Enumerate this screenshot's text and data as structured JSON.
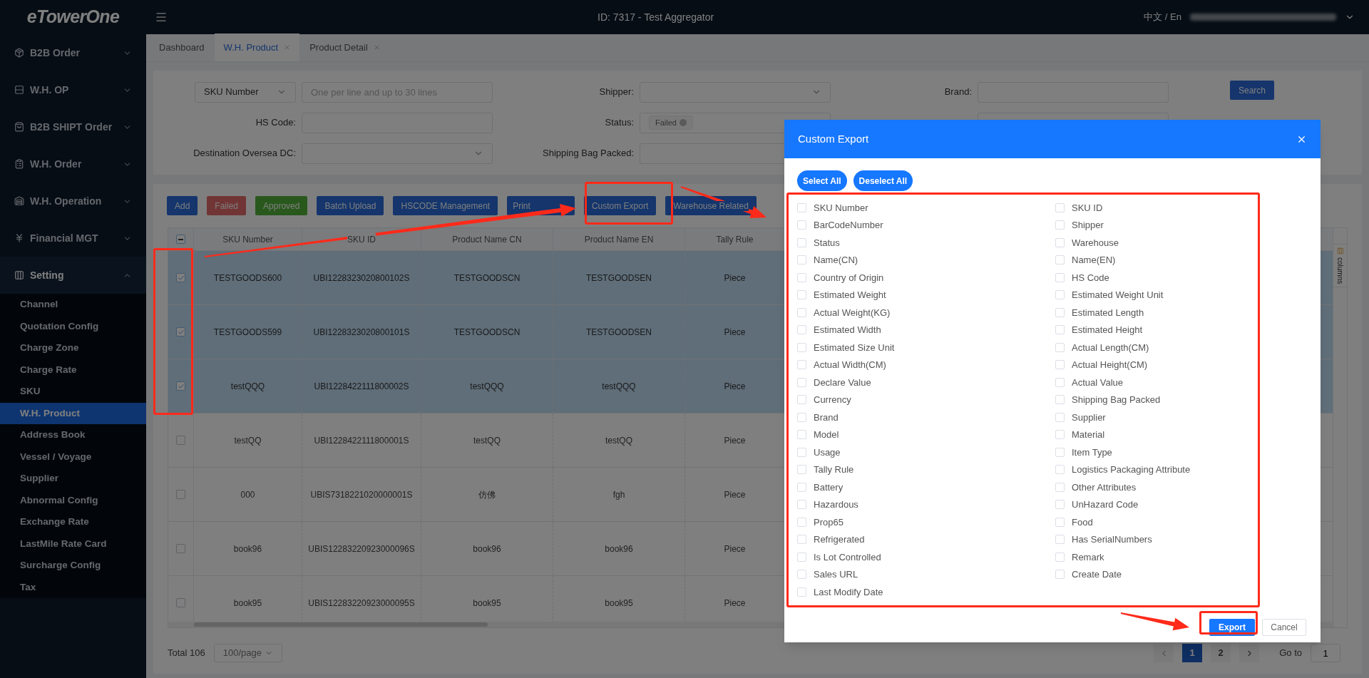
{
  "brand": "eTowerOne",
  "header": {
    "title": "ID: 7317 - Test Aggregator",
    "language": "中文 / En"
  },
  "sidebar": {
    "groups": [
      {
        "label": "B2B Order",
        "expanded": false
      },
      {
        "label": "W.H. OP",
        "expanded": false
      },
      {
        "label": "B2B SHIPT Order",
        "expanded": false
      },
      {
        "label": "W.H. Order",
        "expanded": false
      },
      {
        "label": "W.H. Operation",
        "expanded": false
      },
      {
        "label": "Financial MGT",
        "expanded": false
      },
      {
        "label": "Setting",
        "expanded": true,
        "children": [
          {
            "label": "Channel",
            "selected": false
          },
          {
            "label": "Quotation Config",
            "selected": false
          },
          {
            "label": "Charge Zone",
            "selected": false
          },
          {
            "label": "Charge Rate",
            "selected": false
          },
          {
            "label": "SKU",
            "selected": false
          },
          {
            "label": "W.H. Product",
            "selected": true
          },
          {
            "label": "Address Book",
            "selected": false
          },
          {
            "label": "Vessel / Voyage",
            "selected": false
          },
          {
            "label": "Supplier",
            "selected": false
          },
          {
            "label": "Abnormal Config",
            "selected": false
          },
          {
            "label": "Exchange Rate",
            "selected": false
          },
          {
            "label": "LastMile Rate Card",
            "selected": false
          },
          {
            "label": "Surcharge Config",
            "selected": false
          },
          {
            "label": "Tax",
            "selected": false
          }
        ]
      }
    ]
  },
  "tabs": [
    {
      "label": "Dashboard",
      "selected": false,
      "closable": false
    },
    {
      "label": "W.H. Product",
      "selected": true,
      "closable": true
    },
    {
      "label": "Product Detail",
      "selected": false,
      "closable": true
    }
  ],
  "filters": {
    "rows": [
      [
        {
          "kind": "select-input",
          "value": "SKU Number",
          "placeholder": "One per line and up to 30 lines"
        },
        {
          "kind": "select",
          "label": "Shipper:"
        },
        {
          "kind": "input",
          "label": "Brand:"
        }
      ],
      [
        {
          "kind": "input",
          "label": "HS Code:"
        },
        {
          "kind": "tags",
          "label": "Status:",
          "tags": [
            "Failed"
          ]
        },
        {
          "kind": "input"
        }
      ],
      [
        {
          "kind": "select",
          "label": "Destination Oversea DC:"
        },
        {
          "kind": "input",
          "label": "Shipping Bag Packed:"
        }
      ]
    ],
    "search": "Search"
  },
  "toolbar": [
    {
      "label": "Add",
      "kind": "primary"
    },
    {
      "label": "Failed",
      "kind": "danger"
    },
    {
      "label": "Approved",
      "kind": "success"
    },
    {
      "label": "Batch Upload",
      "kind": "primary"
    },
    {
      "label": "HSCODE Management",
      "kind": "primary"
    },
    {
      "label": "Print",
      "kind": "primary"
    },
    {
      "label": "Custom Export",
      "kind": "primary"
    },
    {
      "label": "Warehouse Related",
      "kind": "primary"
    }
  ],
  "table": {
    "header_checkbox": {
      "indeterminate": true
    },
    "columns": [
      "SKU Number",
      "SKU ID",
      "Product Name CN",
      "Product Name EN",
      "Tally Rule"
    ],
    "rows": [
      {
        "selected": true,
        "cells": [
          "TESTGOODS600",
          "UBI1228323020800102S",
          "TESTGOODSCN",
          "TESTGOODSEN",
          "Piece"
        ]
      },
      {
        "selected": true,
        "cells": [
          "TESTGOODS599",
          "UBI1228323020800101S",
          "TESTGOODSCN",
          "TESTGOODSEN",
          "Piece"
        ]
      },
      {
        "selected": true,
        "cells": [
          "testQQQ",
          "UBI1228422111800002S",
          "testQQQ",
          "testQQQ",
          "Piece"
        ]
      },
      {
        "selected": false,
        "cells": [
          "testQQ",
          "UBI1228422111800001S",
          "testQQ",
          "testQQ",
          "Piece"
        ]
      },
      {
        "selected": false,
        "cells": [
          "000",
          "UBIS7318221020000001S",
          "仿佛",
          "fgh",
          "Piece"
        ]
      },
      {
        "selected": false,
        "cells": [
          "book96",
          "UBIS12283220923000096S",
          "book96",
          "book96",
          "Piece"
        ]
      },
      {
        "selected": false,
        "cells": [
          "book95",
          "UBIS12283220923000095S",
          "book95",
          "book95",
          "Piece"
        ]
      }
    ],
    "columns_tab": "columns"
  },
  "pagination": {
    "total": "Total 106",
    "page_size": "100/page",
    "pages": [
      {
        "label": "1",
        "selected": true
      },
      {
        "label": "2",
        "selected": false
      }
    ],
    "goto": "Go to",
    "goto_value": "1"
  },
  "dialog": {
    "title": "Custom Export",
    "select_all": "Select All",
    "deselect_all": "Deselect All",
    "fields": [
      {
        "label": "SKU Number",
        "checked": false
      },
      {
        "label": "SKU ID",
        "checked": false
      },
      {
        "label": "BarCodeNumber",
        "checked": false
      },
      {
        "label": "Shipper",
        "checked": false
      },
      {
        "label": "Status",
        "checked": false
      },
      {
        "label": "Warehouse",
        "checked": false
      },
      {
        "label": "Name(CN)",
        "checked": false
      },
      {
        "label": "Name(EN)",
        "checked": false
      },
      {
        "label": "Country of Origin",
        "checked": false
      },
      {
        "label": "HS Code",
        "checked": false
      },
      {
        "label": "Estimated Weight",
        "checked": false
      },
      {
        "label": "Estimated Weight Unit",
        "checked": false
      },
      {
        "label": "Actual Weight(KG)",
        "checked": false
      },
      {
        "label": "Estimated Length",
        "checked": false
      },
      {
        "label": "Estimated Width",
        "checked": false
      },
      {
        "label": "Estimated Height",
        "checked": false
      },
      {
        "label": "Estimated Size Unit",
        "checked": false
      },
      {
        "label": "Actual Length(CM)",
        "checked": false
      },
      {
        "label": "Actual Width(CM)",
        "checked": false
      },
      {
        "label": "Actual Height(CM)",
        "checked": false
      },
      {
        "label": "Declare Value",
        "checked": false
      },
      {
        "label": "Actual Value",
        "checked": false
      },
      {
        "label": "Currency",
        "checked": false
      },
      {
        "label": "Shipping Bag Packed",
        "checked": false
      },
      {
        "label": "Brand",
        "checked": false
      },
      {
        "label": "Supplier",
        "checked": false
      },
      {
        "label": "Model",
        "checked": false
      },
      {
        "label": "Material",
        "checked": false
      },
      {
        "label": "Usage",
        "checked": false
      },
      {
        "label": "Item Type",
        "checked": false
      },
      {
        "label": "Tally Rule",
        "checked": false
      },
      {
        "label": "Logistics Packaging Attribute",
        "checked": false
      },
      {
        "label": "Battery",
        "checked": false
      },
      {
        "label": "Other Attributes",
        "checked": false
      },
      {
        "label": "Hazardous",
        "checked": false
      },
      {
        "label": "UnHazard Code",
        "checked": false
      },
      {
        "label": "Prop65",
        "checked": false
      },
      {
        "label": "Food",
        "checked": false
      },
      {
        "label": "Refrigerated",
        "checked": false
      },
      {
        "label": "Has SerialNumbers",
        "checked": false
      },
      {
        "label": "Is Lot Controlled",
        "checked": false
      },
      {
        "label": "Remark",
        "checked": false
      },
      {
        "label": "Sales URL",
        "checked": false
      },
      {
        "label": "Create Date",
        "checked": false
      },
      {
        "label": "Last Modify Date",
        "checked": false
      }
    ],
    "export": "Export",
    "cancel": "Cancel"
  }
}
